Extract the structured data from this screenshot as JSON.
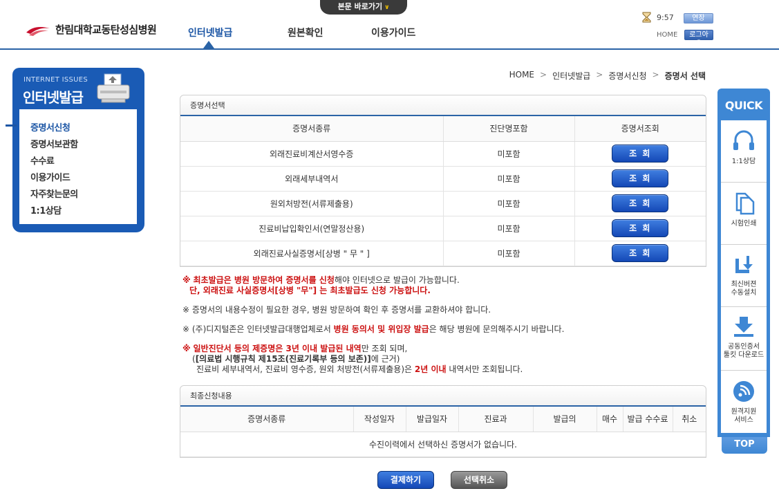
{
  "skip": {
    "label": "본문 바로가기"
  },
  "header": {
    "hospital_name": "한림대학교동탄성심병원",
    "nav": [
      {
        "label": "인터넷발급"
      },
      {
        "label": "원본확인"
      },
      {
        "label": "이용가이드"
      }
    ],
    "time": "9:57",
    "extend_label": "연장",
    "home_label": "HOME",
    "logout_label": "로그아웃"
  },
  "sidebar": {
    "subtitle": "INTERNET ISSUES",
    "title": "인터넷발급",
    "items": [
      {
        "label": "증명서신청"
      },
      {
        "label": "증명서보관함"
      },
      {
        "label": "수수료"
      },
      {
        "label": "이용가이드"
      },
      {
        "label": "자주찾는문의"
      },
      {
        "label": "1:1상담"
      }
    ]
  },
  "breadcrumb": {
    "items": [
      "HOME",
      "인터넷발급",
      "증명서신청",
      "증명서 선택"
    ],
    "separator": ">"
  },
  "cert_select": {
    "title": "증명서선택",
    "columns": [
      "증명서종류",
      "진단명포함",
      "증명서조회"
    ],
    "rows": [
      {
        "name": "외래진료비계산서영수증",
        "diag": "미포함",
        "action": "조 회"
      },
      {
        "name": "외래세부내역서",
        "diag": "미포함",
        "action": "조 회"
      },
      {
        "name": "원외처방전(서류제출용)",
        "diag": "미포함",
        "action": "조 회"
      },
      {
        "name": "진료비납입확인서(연말정산용)",
        "diag": "미포함",
        "action": "조 회"
      },
      {
        "name": "외래진료사실증명서[상병 \" 무 \" ]",
        "diag": "미포함",
        "action": "조 회"
      }
    ]
  },
  "notes": {
    "n1_mark": "※",
    "n1_red": "최초발급은 병원 방문하여 증명서를 신청",
    "n1_rest": "해야 인터넷으로 발급이 가능합니다.",
    "n1_line2": "단, 외래진료 사실증명서[상병 \"무\"] 는 최초발급도 신청 가능합니다.",
    "n2": "※ 증명서의 내용수정이 필요한 경우, 병원 방문하여 확인 후 증명서를 교환하셔야 합니다.",
    "n3_pre": "※ (주)디지털존은 인터넷발급대행업체로서 ",
    "n3_red": "병원 동의서 및 위입장 발급",
    "n3_post": "은 해당 병원에 문의해주시기 바랍니다.",
    "n4_mark": "※",
    "n4_red": "일반진단서 등의 제증명은 3년 이내 발급된 내역",
    "n4_rest": "만 조회 되며,",
    "n4_line2_pre": "(",
    "n4_line2_bold": "[의료법 시행규칙 제15조(진료기록부 등의 보존)]",
    "n4_line2_post": "에 근거)",
    "n4_line3_pre": "진료비 세부내역서, 진료비 영수증, 원외 처방전(서류제출용)은 ",
    "n4_line3_red": "2년 이내",
    "n4_line3_post": " 내역서만 조회됩니다."
  },
  "final_request": {
    "title": "최종신청내용",
    "columns": [
      "증명서종류",
      "작성일자",
      "발급일자",
      "진료과",
      "발급의",
      "매수",
      "발급 수수료",
      "취소"
    ],
    "empty_message": "수진이력에서 선택하신 증명서가 없습니다."
  },
  "buttons": {
    "pay": "결제하기",
    "cancel": "선택취소"
  },
  "quick": {
    "title": "QUICK",
    "items": [
      {
        "label": "1:1상담",
        "icon": "headset-icon"
      },
      {
        "label": "시험인쇄",
        "icon": "document-icon"
      },
      {
        "label": "최신버젼\n수동설치",
        "icon": "install-icon"
      },
      {
        "label": "공동인증서\n툴킷 다운로드",
        "icon": "download-icon"
      },
      {
        "label": "원격지원\n서비스",
        "icon": "remote-icon"
      }
    ],
    "top_label": "TOP"
  },
  "colors": {
    "brand_blue": "#1c56a5",
    "accent_red": "#cc1111",
    "quick_blue": "#3e87d4"
  }
}
